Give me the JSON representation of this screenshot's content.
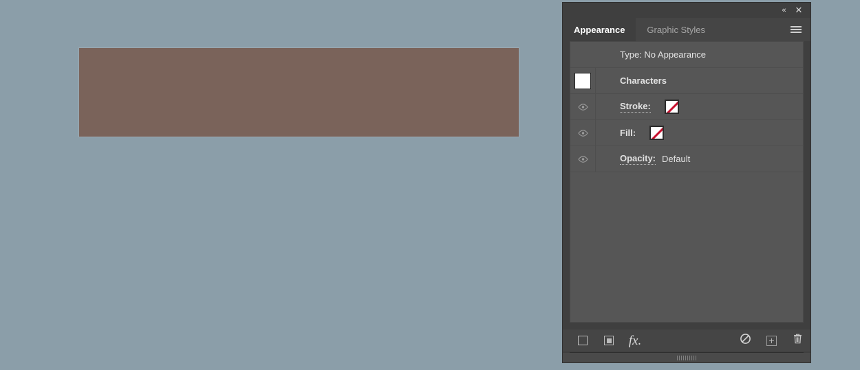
{
  "canvas": {
    "background_color": "#8b9ea9",
    "artwork": {
      "name": "brown-rectangle",
      "fill_color": "#7a635a",
      "border_color": "#9aa9b2"
    }
  },
  "panel": {
    "background_color": "#3f3f3f",
    "titlebar": {
      "collapse_icon": "double-chevron-left-icon",
      "collapse_glyph": "«",
      "close_icon": "close-icon",
      "close_glyph": "✕"
    },
    "tabs": [
      {
        "label": "Appearance",
        "active": true
      },
      {
        "label": "Graphic Styles",
        "active": false
      }
    ],
    "menu_icon": "hamburger-menu-icon",
    "rows": [
      {
        "id": "type",
        "label": "Type: No Appearance",
        "has_eye": false,
        "has_thumbnail": false,
        "dotted_underline": false,
        "bold": false
      },
      {
        "id": "characters",
        "label": "Characters",
        "has_eye": false,
        "has_thumbnail": true,
        "dotted_underline": false,
        "bold": true
      },
      {
        "id": "stroke",
        "label": "Stroke:",
        "has_eye": true,
        "has_thumbnail": false,
        "dotted_underline": true,
        "bold": true,
        "swatch": "none-swatch",
        "swatch_value": "None"
      },
      {
        "id": "fill",
        "label": "Fill:",
        "has_eye": true,
        "has_thumbnail": false,
        "dotted_underline": false,
        "bold": true,
        "swatch": "none-swatch",
        "swatch_value": "None"
      },
      {
        "id": "opacity",
        "label": "Opacity:",
        "value": "Default",
        "has_eye": true,
        "has_thumbnail": false,
        "dotted_underline": true,
        "bold": true
      }
    ],
    "toolbar": [
      {
        "id": "add-new-stroke",
        "icon": "square-outline-icon"
      },
      {
        "id": "add-new-fill",
        "icon": "square-in-square-icon"
      },
      {
        "id": "add-new-effect",
        "icon": "fx-icon",
        "glyph": "fx."
      },
      {
        "id": "clear-appearance",
        "icon": "no-symbol-icon"
      },
      {
        "id": "duplicate-item",
        "icon": "plus-square-icon"
      },
      {
        "id": "delete-item",
        "icon": "trash-icon"
      }
    ],
    "resize_grip": "resize-grip"
  }
}
